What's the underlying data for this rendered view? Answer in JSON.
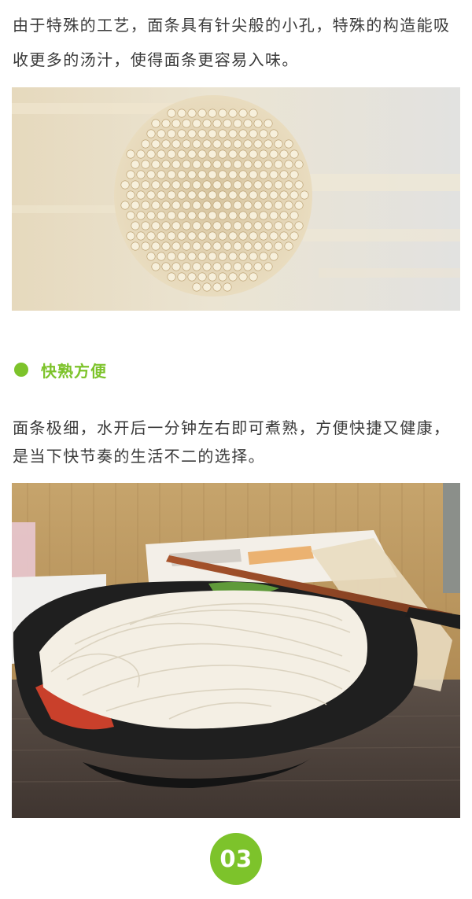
{
  "intro": {
    "text": "由于特殊的工艺，面条具有针尖般的小孔，特殊的构造能吸收更多的汤汁，使得面条更容易入味。"
  },
  "feature": {
    "title": "快熟方便",
    "text": "面条极细，水开后一分钟左右即可煮熟，方便快捷又健康，是当下快节奏的生活不二的选择。"
  },
  "section_number": "03",
  "colors": {
    "accent": "#7dc32b",
    "text": "#3a3a3a"
  }
}
